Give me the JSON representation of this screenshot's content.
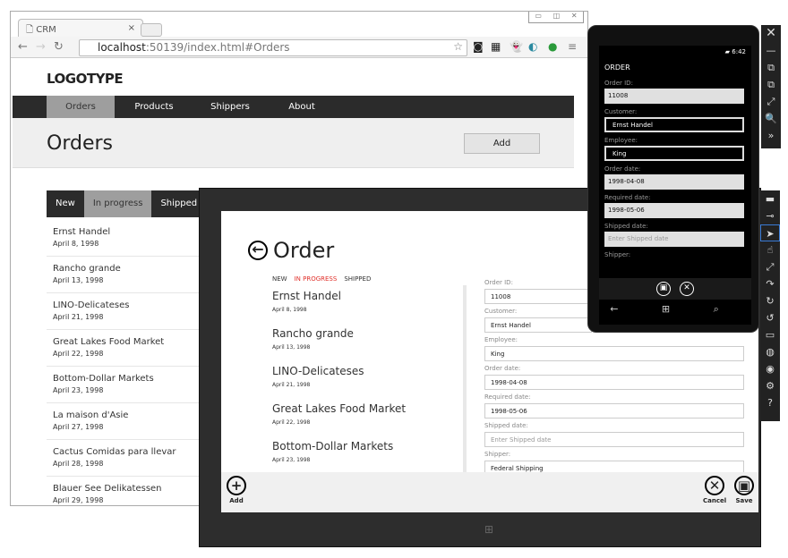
{
  "browser": {
    "tab_title": "CRM",
    "url_host": "localhost",
    "url_rest": ":50139/index.html#Orders"
  },
  "web": {
    "logo": "LOGOTYPE",
    "nav": [
      "Orders",
      "Products",
      "Shippers",
      "About"
    ],
    "title": "Orders",
    "add_label": "Add",
    "status_tabs": [
      "New",
      "In progress",
      "Shipped"
    ],
    "orders": [
      {
        "name": "Ernst Handel",
        "date": "April 8, 1998"
      },
      {
        "name": "Rancho grande",
        "date": "April 13, 1998"
      },
      {
        "name": "LINO-Delicateses",
        "date": "April 21, 1998"
      },
      {
        "name": "Great Lakes Food Market",
        "date": "April 22, 1998"
      },
      {
        "name": "Bottom-Dollar Markets",
        "date": "April 23, 1998"
      },
      {
        "name": "La maison d'Asie",
        "date": "April 27, 1998"
      },
      {
        "name": "Cactus Comidas para llevar",
        "date": "April 28, 1998"
      },
      {
        "name": "Blauer See Delikatessen",
        "date": "April 29, 1998"
      }
    ]
  },
  "win8": {
    "title": "Order",
    "tabs": [
      "NEW",
      "IN PROGRESS",
      "SHIPPED"
    ],
    "orders": [
      {
        "name": "Ernst Handel",
        "date": "April 8, 1998"
      },
      {
        "name": "Rancho grande",
        "date": "April 13, 1998"
      },
      {
        "name": "LINO-Delicateses",
        "date": "April 21, 1998"
      },
      {
        "name": "Great Lakes Food Market",
        "date": "April 22, 1998"
      },
      {
        "name": "Bottom-Dollar Markets",
        "date": "April 23, 1998"
      }
    ],
    "fields": [
      {
        "label": "Order ID:",
        "value": "11008"
      },
      {
        "label": "Customer:",
        "value": "Ernst Handel"
      },
      {
        "label": "Employee:",
        "value": "King"
      },
      {
        "label": "Order date:",
        "value": "1998-04-08"
      },
      {
        "label": "Required date:",
        "value": "1998-05-06"
      },
      {
        "label": "Shipped date:",
        "placeholder": "Enter Shipped date"
      },
      {
        "label": "Shipper:",
        "value": "Federal Shipping"
      }
    ],
    "add_label": "Add",
    "cancel_label": "Cancel",
    "save_label": "Save"
  },
  "phone": {
    "time": "6:42",
    "title": "ORDER",
    "fields": [
      {
        "label": "Order ID:",
        "value": "11008"
      },
      {
        "label": "Customer:",
        "value": "Ernst Handel"
      },
      {
        "label": "Employee:",
        "value": "King"
      },
      {
        "label": "Order date:",
        "value": "1998-04-08"
      },
      {
        "label": "Required date:",
        "value": "1998-05-06"
      },
      {
        "label": "Shipped date:",
        "placeholder": "Enter Shipped date"
      },
      {
        "label": "Shipper:"
      }
    ]
  },
  "colors": {
    "accent_red": "#e0302a",
    "nav_dark": "#2b2b2b",
    "active_gray": "#9e9e9e"
  }
}
